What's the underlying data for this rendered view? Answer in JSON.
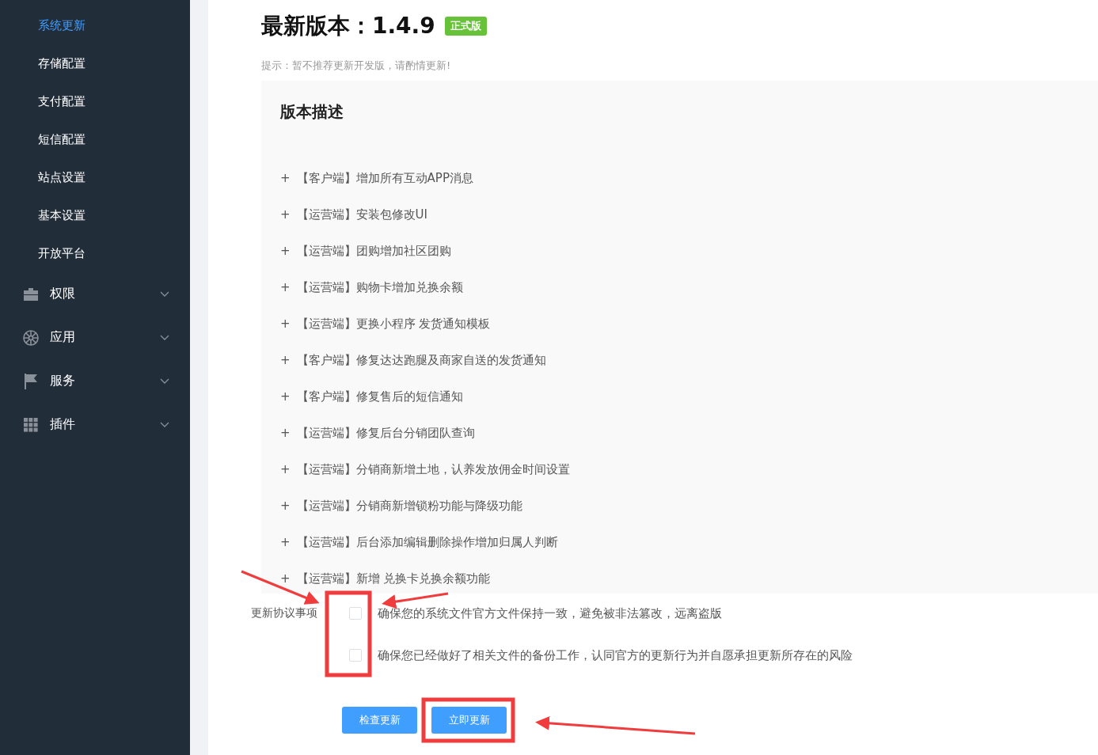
{
  "sidebar": {
    "submenu_items": [
      {
        "label": "系统更新",
        "selected": true
      },
      {
        "label": "存储配置",
        "selected": false
      },
      {
        "label": "支付配置",
        "selected": false
      },
      {
        "label": "短信配置",
        "selected": false
      },
      {
        "label": "站点设置",
        "selected": false
      },
      {
        "label": "基本设置",
        "selected": false
      },
      {
        "label": "开放平台",
        "selected": false
      }
    ],
    "groups": [
      {
        "label": "权限",
        "expanded": false
      },
      {
        "label": "应用",
        "expanded": false
      },
      {
        "label": "服务",
        "expanded": false
      },
      {
        "label": "插件",
        "expanded": false
      }
    ]
  },
  "header": {
    "title": "最新版本：1.4.9",
    "badge": "正式版",
    "hint": "提示：暂不推荐更新开发版，请酌情更新!"
  },
  "changelog": {
    "title": "版本描述",
    "items": [
      {
        "bullet": "+",
        "text": "【客户端】增加所有互动APP消息"
      },
      {
        "bullet": "+",
        "text": "【运营端】安装包修改UI"
      },
      {
        "bullet": "+",
        "text": "【运营端】团购增加社区团购"
      },
      {
        "bullet": "+",
        "text": "【运营端】购物卡增加兑换余额"
      },
      {
        "bullet": "+",
        "text": "【运营端】更换小程序 发货通知模板"
      },
      {
        "bullet": "+",
        "text": "【客户端】修复达达跑腿及商家自送的发货通知"
      },
      {
        "bullet": "+",
        "text": "【客户端】修复售后的短信通知"
      },
      {
        "bullet": "+",
        "text": "【运营端】修复后台分销团队查询"
      },
      {
        "bullet": "+",
        "text": "【运营端】分销商新增土地，认养发放佣金时间设置"
      },
      {
        "bullet": "+",
        "text": "【运营端】分销商新增锁粉功能与降级功能"
      },
      {
        "bullet": "+",
        "text": "【运营端】后台添加编辑删除操作增加归属人判断"
      },
      {
        "bullet": "+",
        "text": "【运营端】新增 兑换卡兑换余额功能"
      }
    ]
  },
  "agreement": {
    "label": "更新协议事项",
    "options": [
      {
        "text": "确保您的系统文件官方文件保持一致，避免被非法篡改，远离盗版",
        "checked": false
      },
      {
        "text": "确保您已经做好了相关文件的备份工作，认同官方的更新行为并自愿承担更新所存在的风险",
        "checked": false
      }
    ]
  },
  "buttons": [
    {
      "label": "检查更新"
    },
    {
      "label": "立即更新"
    }
  ]
}
